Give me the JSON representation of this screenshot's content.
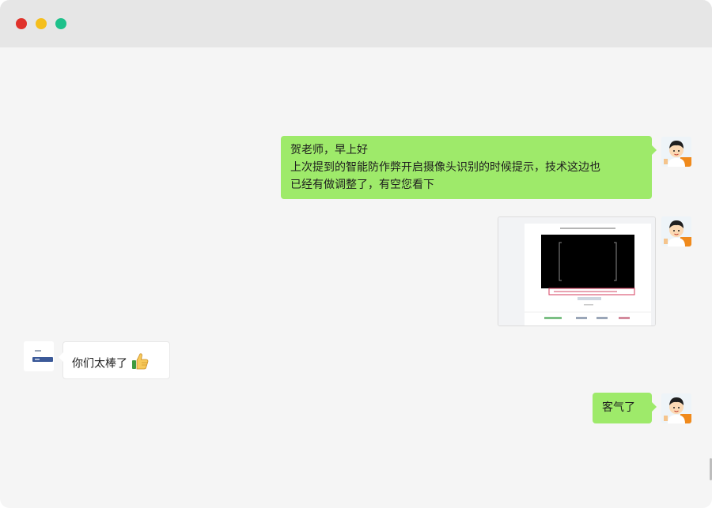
{
  "window": {
    "traffic_lights": {
      "close": "#e0322b",
      "minimize": "#f5bf1c",
      "zoom": "#1ec18b"
    }
  },
  "colors": {
    "outgoing_bubble": "#9eea6a",
    "incoming_bubble": "#ffffff",
    "chat_background": "#f5f5f5"
  },
  "messages": [
    {
      "direction": "outgoing",
      "type": "text",
      "lines": [
        "贺老师，早上好",
        "上次提到的智能防作弊开启摄像头识别的时候提示，技术这边也",
        "已经有做调整了，有空您看下"
      ]
    },
    {
      "direction": "outgoing",
      "type": "image",
      "icon": "screenshot-thumbnail"
    },
    {
      "direction": "incoming",
      "type": "text",
      "text": "你们太棒了",
      "emoji": "thumbs-up-icon"
    },
    {
      "direction": "outgoing",
      "type": "text",
      "text": "客气了"
    }
  ],
  "avatars": {
    "self": "cartoon-boy-avatar",
    "other": "company-logo-avatar"
  }
}
